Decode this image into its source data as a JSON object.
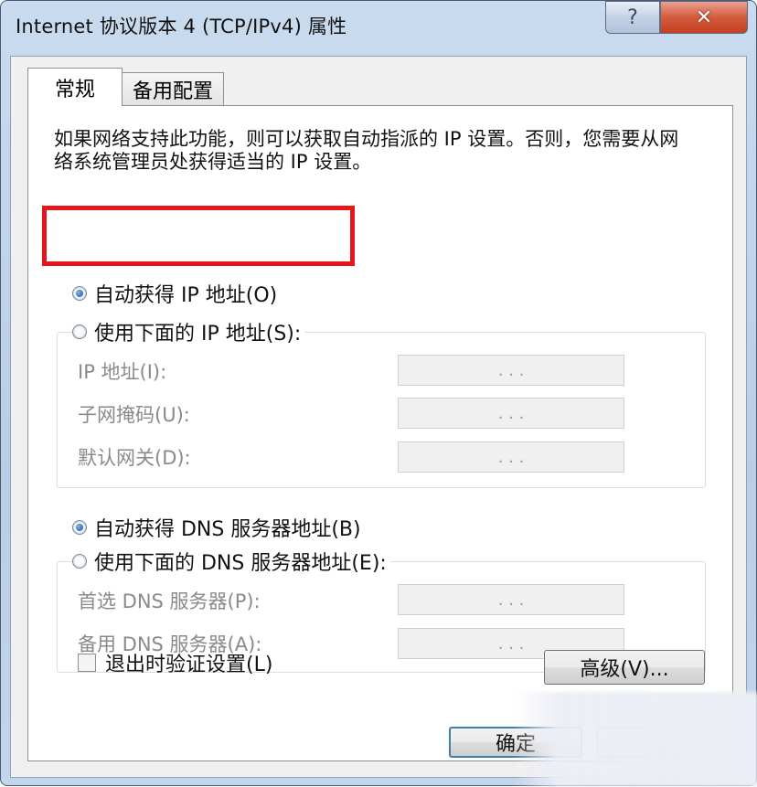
{
  "window": {
    "title": "Internet 协议版本 4 (TCP/IPv4) 属性",
    "help_label": "?",
    "close_label": "✕"
  },
  "tabs": [
    {
      "label": "常规",
      "active": true
    },
    {
      "label": "备用配置",
      "active": false
    }
  ],
  "description": "如果网络支持此功能，则可以获取自动指派的 IP 设置。否则，您需要从网络系统管理员处获得适当的 IP 设置。",
  "ip_section": {
    "auto_label": "自动获得 IP 地址(O)",
    "auto_selected": true,
    "manual_label": "使用下面的 IP 地址(S):",
    "fields": [
      {
        "label": "IP 地址(I):",
        "value": ". . ."
      },
      {
        "label": "子网掩码(U):",
        "value": ". . ."
      },
      {
        "label": "默认网关(D):",
        "value": ". . ."
      }
    ]
  },
  "dns_section": {
    "auto_label": "自动获得 DNS 服务器地址(B)",
    "auto_selected": true,
    "manual_label": "使用下面的 DNS 服务器地址(E):",
    "fields": [
      {
        "label": "首选 DNS 服务器(P):",
        "value": ". . ."
      },
      {
        "label": "备用 DNS 服务器(A):",
        "value": ". . ."
      }
    ]
  },
  "validate_on_exit": {
    "label": "退出时验证设置(L)",
    "checked": false
  },
  "buttons": {
    "advanced": "高级(V)...",
    "ok": "确定"
  },
  "highlight_color": "#e4171e"
}
